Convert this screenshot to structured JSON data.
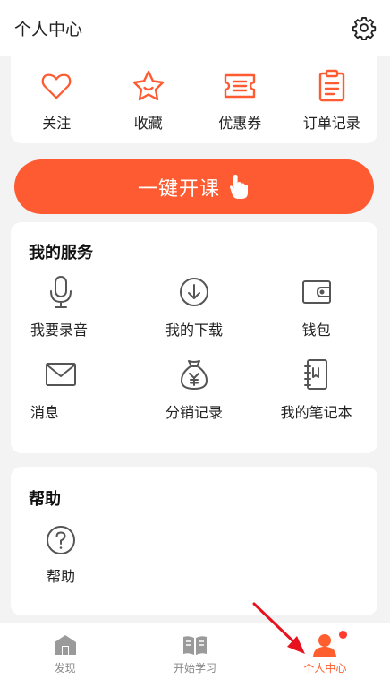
{
  "header": {
    "title": "个人中心",
    "settings_icon": "gear-icon"
  },
  "quick_actions": [
    {
      "label": "关注",
      "icon": "heart-icon"
    },
    {
      "label": "收藏",
      "icon": "star-icon"
    },
    {
      "label": "优惠券",
      "icon": "coupon-icon"
    },
    {
      "label": "订单记录",
      "icon": "clipboard-icon"
    }
  ],
  "cta": {
    "label": "一键开课",
    "icon": "tap-hand-icon"
  },
  "services": {
    "title": "我的服务",
    "items": [
      {
        "label": "我要录音",
        "icon": "microphone-icon"
      },
      {
        "label": "我的下载",
        "icon": "download-icon"
      },
      {
        "label": "钱包",
        "icon": "wallet-icon"
      },
      {
        "label": "消息",
        "icon": "mail-icon"
      },
      {
        "label": "分销记录",
        "icon": "money-bag-icon"
      },
      {
        "label": "我的笔记本",
        "icon": "notebook-icon"
      }
    ]
  },
  "help": {
    "title": "帮助",
    "items": [
      {
        "label": "帮助",
        "icon": "question-icon"
      }
    ]
  },
  "tabbar": {
    "tabs": [
      {
        "label": "发现",
        "icon": "home-icon",
        "active": false
      },
      {
        "label": "开始学习",
        "icon": "book-icon",
        "active": false
      },
      {
        "label": "个人中心",
        "icon": "person-icon",
        "active": true
      }
    ]
  },
  "colors": {
    "accent": "#fe5b32",
    "icon_gray": "#555555",
    "badge": "#ff3b30",
    "annotation_arrow": "#e8121f"
  }
}
